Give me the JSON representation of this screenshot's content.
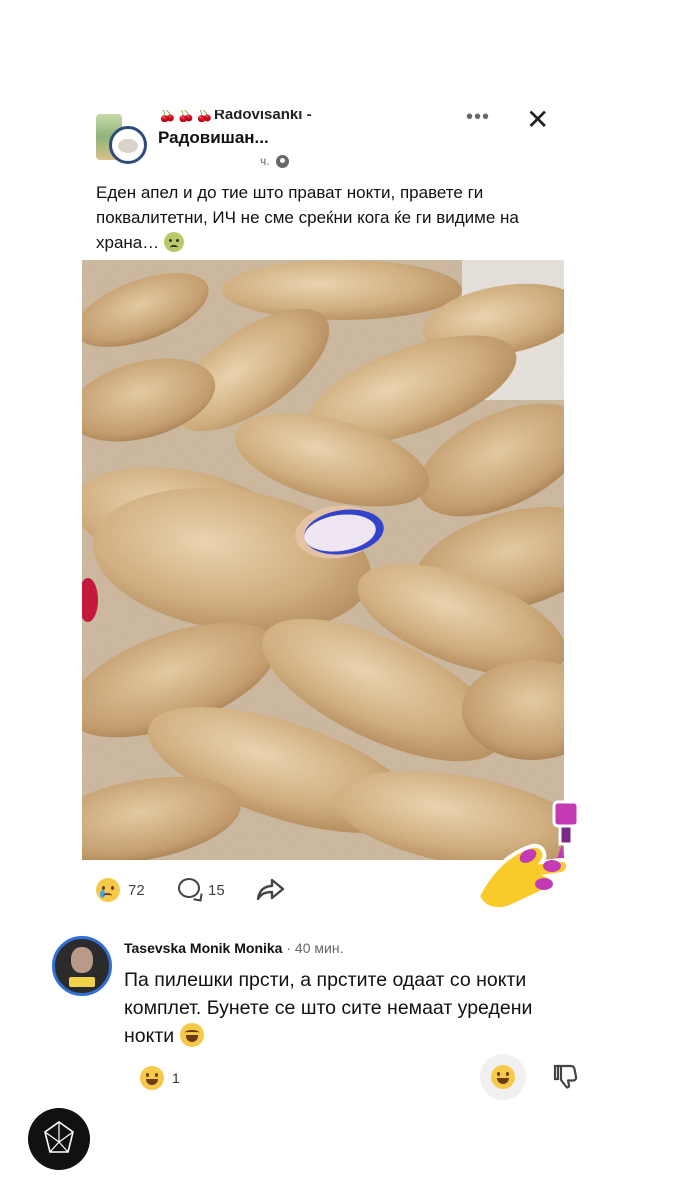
{
  "post": {
    "group_name_top": "🍒🍒🍒Radovisanki -",
    "group_name": "Радовишан...",
    "time": "ч.",
    "more_label": "•••",
    "close_label": "✕",
    "text": "Еден апел и до тие што прават нокти, правете ги поквалитетни, ИЧ не сме среќни кога ќе ги видиме на храна…",
    "reaction_count": "72",
    "comment_count": "15"
  },
  "comment": {
    "author": "Tasevska Monik Monika",
    "time": "· 40 мин.",
    "text": "Па пилешки прсти, а прстите одаат со нокти комплет. Бунете се што сите немаат уредени нокти",
    "reaction_count": "1"
  },
  "colors": {
    "nail_polish": "#3344cc",
    "fried_chicken": "#d9b98a",
    "avatar_ring": "#2f6fd6"
  }
}
